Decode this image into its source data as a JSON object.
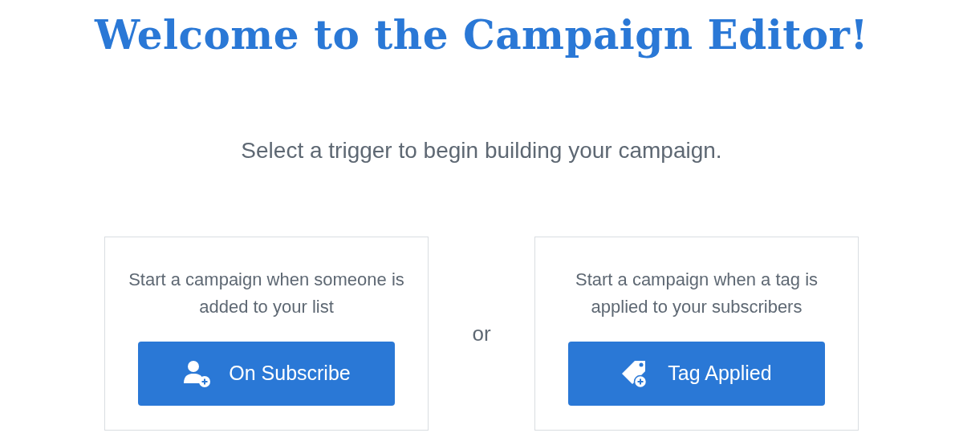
{
  "title": "Welcome to the Campaign Editor!",
  "subtitle": "Select a trigger to begin building your campaign.",
  "separator": "or",
  "triggers": [
    {
      "kind": "subscribe",
      "description": "Start a campaign when someone is added to your list",
      "button": "On Subscribe"
    },
    {
      "kind": "tag",
      "description": "Start a campaign when a tag is applied to your subscribers",
      "button": "Tag Applied"
    }
  ]
}
